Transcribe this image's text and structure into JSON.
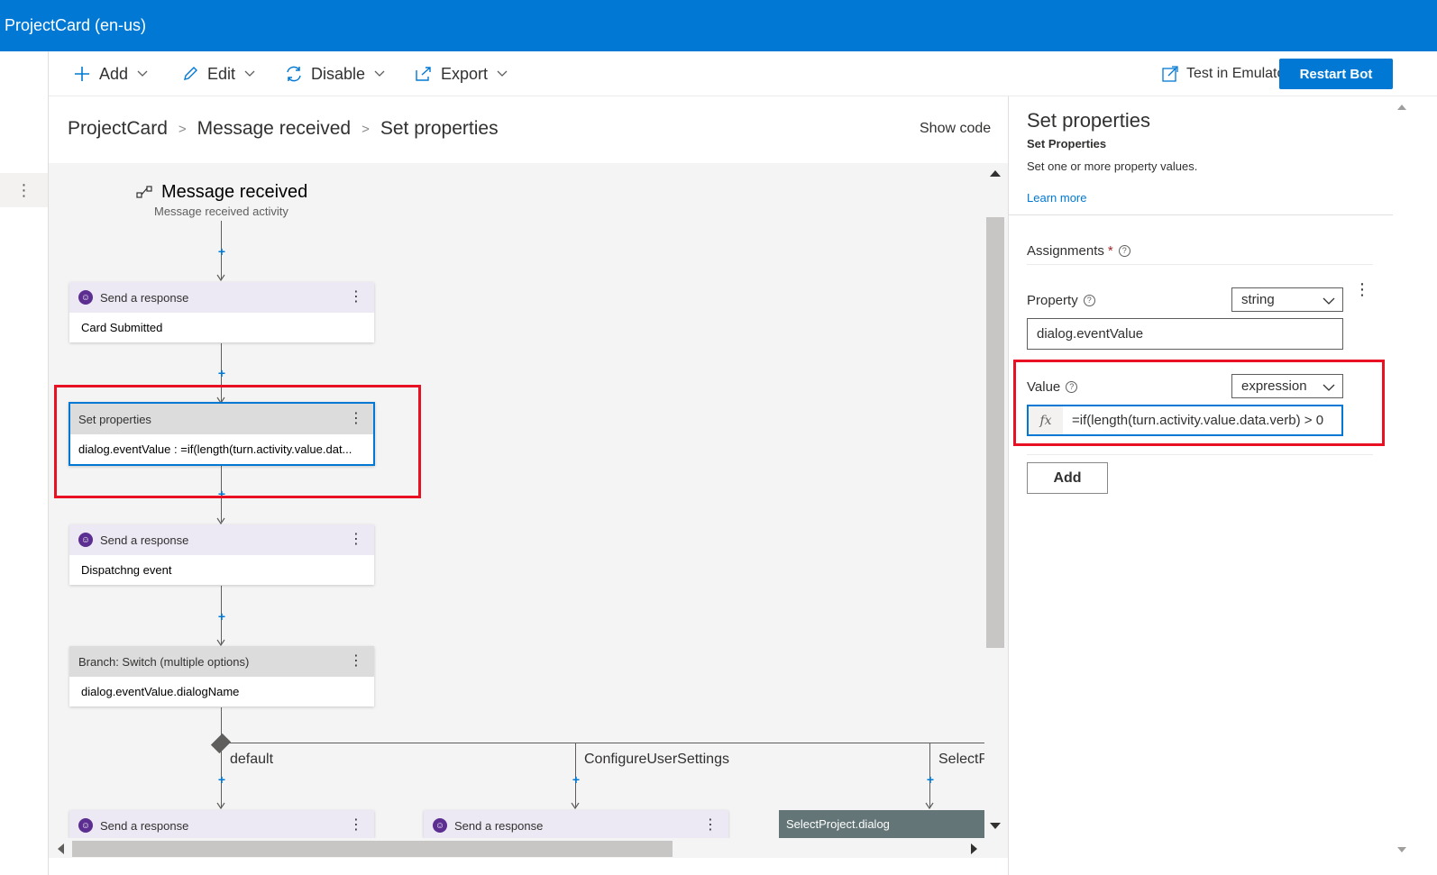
{
  "window": {
    "title": "ProjectCard (en-us)"
  },
  "toolbar": {
    "add_label": "Add",
    "edit_label": "Edit",
    "disable_label": "Disable",
    "export_label": "Export",
    "test_emulator_label": "Test in Emulator",
    "restart_label": "Restart Bot"
  },
  "breadcrumb": [
    "ProjectCard",
    "Message received",
    "Set properties"
  ],
  "show_code_label": "Show code",
  "canvas": {
    "trigger": {
      "title": "Message received",
      "subtitle": "Message received activity"
    },
    "nodes": [
      {
        "header": "Send a response",
        "body": "Card Submitted"
      },
      {
        "header": "Set properties",
        "body": "dialog.eventValue : =if(length(turn.activity.value.dat..."
      },
      {
        "header": "Send a response",
        "body": "Dispatchng event"
      },
      {
        "header": "Branch: Switch (multiple options)",
        "body": "dialog.eventValue.dialogName"
      }
    ],
    "branches": [
      "default",
      "ConfigureUserSettings",
      "SelectP"
    ],
    "branch_nodes": [
      "Send a response",
      "Send a response",
      "SelectProject.dialog"
    ]
  },
  "panel": {
    "title": "Set properties",
    "subtitle": "Set Properties",
    "description": "Set one or more property values.",
    "learn_more": "Learn more",
    "assignments_label": "Assignments",
    "required_mark": "*",
    "property_label": "Property",
    "property_type": "string",
    "property_value": "dialog.eventValue",
    "value_label": "Value",
    "value_type": "expression",
    "fx_label": "fx",
    "value_expression": "=if(length(turn.activity.value.data.verb) > 0",
    "add_button": "Add"
  },
  "colors": {
    "accent": "#0078d4",
    "highlight": "#e81123",
    "bot_icon": "#5c2e91"
  }
}
